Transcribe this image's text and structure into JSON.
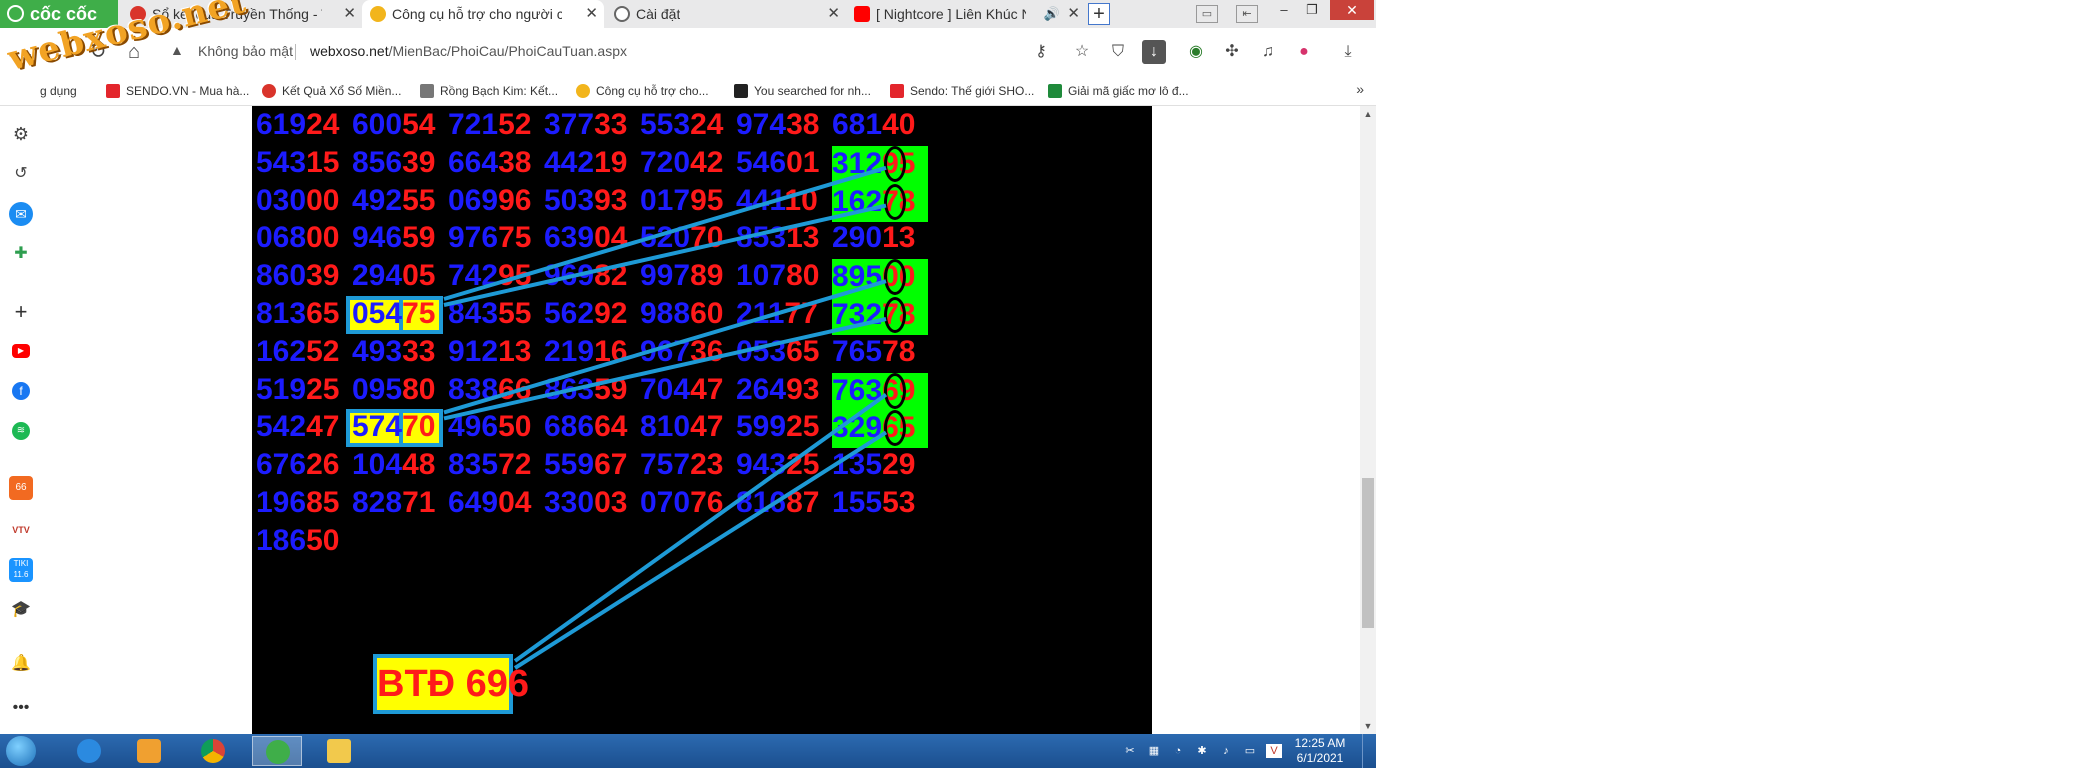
{
  "browser": {
    "name": "cốc cốc",
    "tabs": [
      {
        "title": "Sổ kết quả Truyền Thống - T",
        "close": "✕",
        "active": false,
        "icon_color": "#d9342b"
      },
      {
        "title": "Công cụ hỗ trợ cho người ch",
        "close": "✕",
        "active": true,
        "icon_color": "#f2b51c"
      },
      {
        "title": "Cài đặt",
        "close": "✕",
        "active": false,
        "icon_color": "#666666"
      },
      {
        "title": "[ Nightcore ] Liên Khúc N",
        "close": "✕",
        "active": false,
        "icon_color": "#ff0000",
        "audio_icon": "🔊"
      }
    ],
    "new_tab": "+",
    "window_controls": {
      "minimize": "–",
      "restore": "❐",
      "close": "✕"
    }
  },
  "address_bar": {
    "not_secure": "Không bảo mật",
    "url_host": "webxoso.net",
    "url_path": "/MienBac/PhoiCau/PhoiCauTuan.aspx"
  },
  "bookmarks": [
    {
      "label": "g dụng",
      "icon_color": "#9e9e9e"
    },
    {
      "label": "SENDO.VN - Mua hà...",
      "icon_color": "#e3262c"
    },
    {
      "label": "Kết Quả Xổ Số Miền...",
      "icon_color": "#d9342b"
    },
    {
      "label": "Rồng Bạch Kim: Kết...",
      "icon_color": "#777777"
    },
    {
      "label": "Công cụ hỗ trợ cho...",
      "icon_color": "#f2b51c"
    },
    {
      "label": "You searched for nh...",
      "icon_color": "#222222"
    },
    {
      "label": "Sendo: Thế giới SHO...",
      "icon_color": "#e3262c"
    },
    {
      "label": "Giải mã giấc mơ lô đ...",
      "icon_color": "#1f8a3b"
    }
  ],
  "bookmarks_more": "»",
  "watermark": "webxoso.net",
  "board": {
    "rows": [
      [
        "61924",
        "60054",
        "72152",
        "37733",
        "55324",
        "97438",
        "68140"
      ],
      [
        "54315",
        "85639",
        "66438",
        "44219",
        "72042",
        "54601",
        "31295"
      ],
      [
        "03000",
        "49255",
        "06996",
        "50393",
        "01795",
        "44110",
        "16278"
      ],
      [
        "06800",
        "94659",
        "97675",
        "63904",
        "52070",
        "85313",
        "29013"
      ],
      [
        "86039",
        "29405",
        "74295",
        "96982",
        "99789",
        "10780",
        "89500"
      ],
      [
        "81365",
        "05475",
        "84355",
        "56292",
        "98860",
        "21177",
        "73278"
      ],
      [
        "16252",
        "49333",
        "91213",
        "21916",
        "96736",
        "05365",
        "76578"
      ],
      [
        "51925",
        "09580",
        "83866",
        "86359",
        "70447",
        "26493",
        "76369"
      ],
      [
        "54247",
        "57470",
        "49650",
        "68664",
        "81047",
        "59925",
        "32965"
      ],
      [
        "67626",
        "10448",
        "83572",
        "55967",
        "75723",
        "94325",
        "13529"
      ],
      [
        "19685",
        "82871",
        "64904",
        "33003",
        "07076",
        "81687",
        "15553"
      ],
      [
        "18650"
      ]
    ],
    "green_cells": [
      [
        1,
        6
      ],
      [
        2,
        6
      ],
      [
        4,
        6
      ],
      [
        5,
        6
      ],
      [
        7,
        6
      ],
      [
        8,
        6
      ]
    ],
    "yellow_cells": [
      [
        5,
        1
      ],
      [
        8,
        1
      ]
    ],
    "btd_label": "BTĐ 696",
    "colors": {
      "hi": "#1c1cff",
      "lo": "#ff1a1a",
      "green": "#00ff00",
      "yellow": "#ffff00",
      "line": "#1e9ad6",
      "background": "#000000"
    }
  },
  "clock": {
    "time": "12:25 AM",
    "date": "6/1/2021"
  }
}
